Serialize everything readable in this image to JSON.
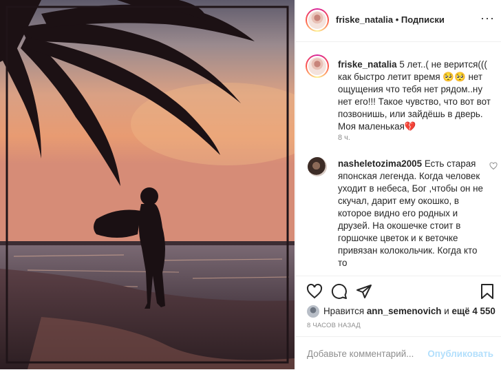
{
  "header": {
    "username": "friske_natalia",
    "dot": "•",
    "follow": "Подписки",
    "more": "···"
  },
  "caption": {
    "username": "friske_natalia",
    "text": "5 лет..( не верится((( как быстро летит время 🥺🥺 нет ощущения что тебя нет рядом..ну нет его!!! Такое чувство, что вот вот позвонишь, или зайдёшь в дверь. Моя маленькая💔",
    "time": "8 ч."
  },
  "comment": {
    "username": "nasheletozima2005",
    "text": "Есть старая японская легенда. Когда человек уходит в небеса, Бог ,чтобы он не скучал, дарит ему окошко, в которое видно его родных и друзей. На окошечке стоит в горшочке цветок и к веточке привязан колокольчик. Когда кто то"
  },
  "actions": {
    "like": "heart-icon",
    "comment": "comment-icon",
    "share": "share-icon",
    "save": "bookmark-icon"
  },
  "likes": {
    "prefix": "Нравится",
    "user": "ann_semenovich",
    "conj": "и",
    "others": "ещё 4 550"
  },
  "timestamp": "8 ЧАСОВ НАЗАД",
  "composer": {
    "placeholder": "Добавьте комментарий...",
    "publish": "Опубликовать"
  },
  "colors": {
    "accent_disabled": "#b2dffc",
    "secondary_text": "#8e8e8e",
    "border": "#efefef"
  }
}
